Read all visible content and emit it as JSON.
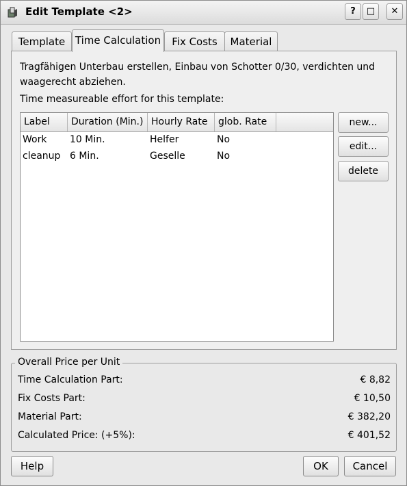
{
  "window": {
    "title": "Edit Template <2>",
    "help_glyph": "?",
    "maximize_glyph": "□",
    "close_glyph": "✕"
  },
  "tabs": [
    {
      "label": "Template",
      "active": false
    },
    {
      "label": "Time Calculation",
      "active": true
    },
    {
      "label": "Fix Costs",
      "active": false
    },
    {
      "label": "Material",
      "active": false
    }
  ],
  "time_calc": {
    "description": "Tragfähigen Unterbau erstellen, Einbau von Schotter 0/30, verdichten und waagerecht abziehen.",
    "list_label": "Time measureable effort for this template:",
    "columns": [
      "Label",
      "Duration (Min.)",
      "Hourly Rate",
      "glob. Rate"
    ],
    "rows": [
      {
        "label": "Work",
        "duration": "10 Min.",
        "rate": "Helfer",
        "glob": "No"
      },
      {
        "label": "cleanup",
        "duration": "6 Min.",
        "rate": "Geselle",
        "glob": "No"
      }
    ],
    "buttons": {
      "new": "new...",
      "edit": "edit...",
      "delete": "delete"
    }
  },
  "overall": {
    "title": "Overall Price per Unit",
    "rows": [
      {
        "label": "Time Calculation Part:",
        "value": "€ 8,82"
      },
      {
        "label": "Fix Costs Part:",
        "value": "€ 10,50"
      },
      {
        "label": "Material Part:",
        "value": "€ 382,20"
      },
      {
        "label": "Calculated Price: (+5%):",
        "value": "€ 401,52"
      }
    ]
  },
  "footer": {
    "help": "Help",
    "ok": "OK",
    "cancel": "Cancel"
  }
}
